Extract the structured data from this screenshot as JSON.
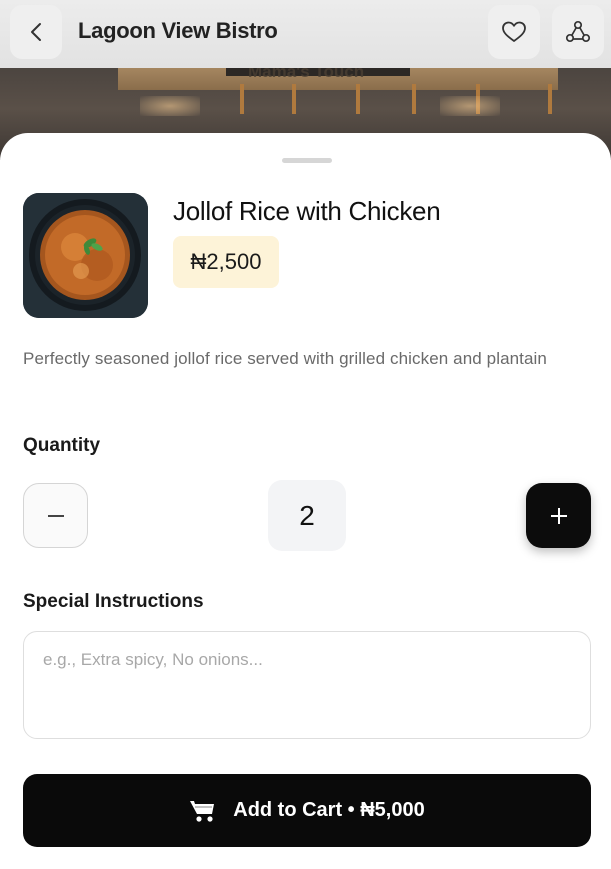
{
  "header": {
    "title": "Lagoon View Bistro",
    "bg_sign_text": "Mama's Touch"
  },
  "dish": {
    "name": "Jollof Rice with Chicken",
    "price": "₦2,500",
    "description": "Perfectly seasoned jollof rice served with grilled chicken and plantain"
  },
  "quantity": {
    "label": "Quantity",
    "value": "2"
  },
  "instructions": {
    "label": "Special Instructions",
    "placeholder": "e.g., Extra spicy, No onions..."
  },
  "cart": {
    "label": "Add to Cart • ₦5,000"
  },
  "icons": {
    "back": "chevron-left-icon",
    "favorite": "heart-icon",
    "share": "share-icon",
    "minus": "minus-icon",
    "plus": "plus-icon",
    "cart": "cart-icon"
  },
  "colors": {
    "accent": "#0a0a0a",
    "price_badge_bg": "#fdf3d8",
    "qty_value_bg": "#f3f4f6"
  }
}
